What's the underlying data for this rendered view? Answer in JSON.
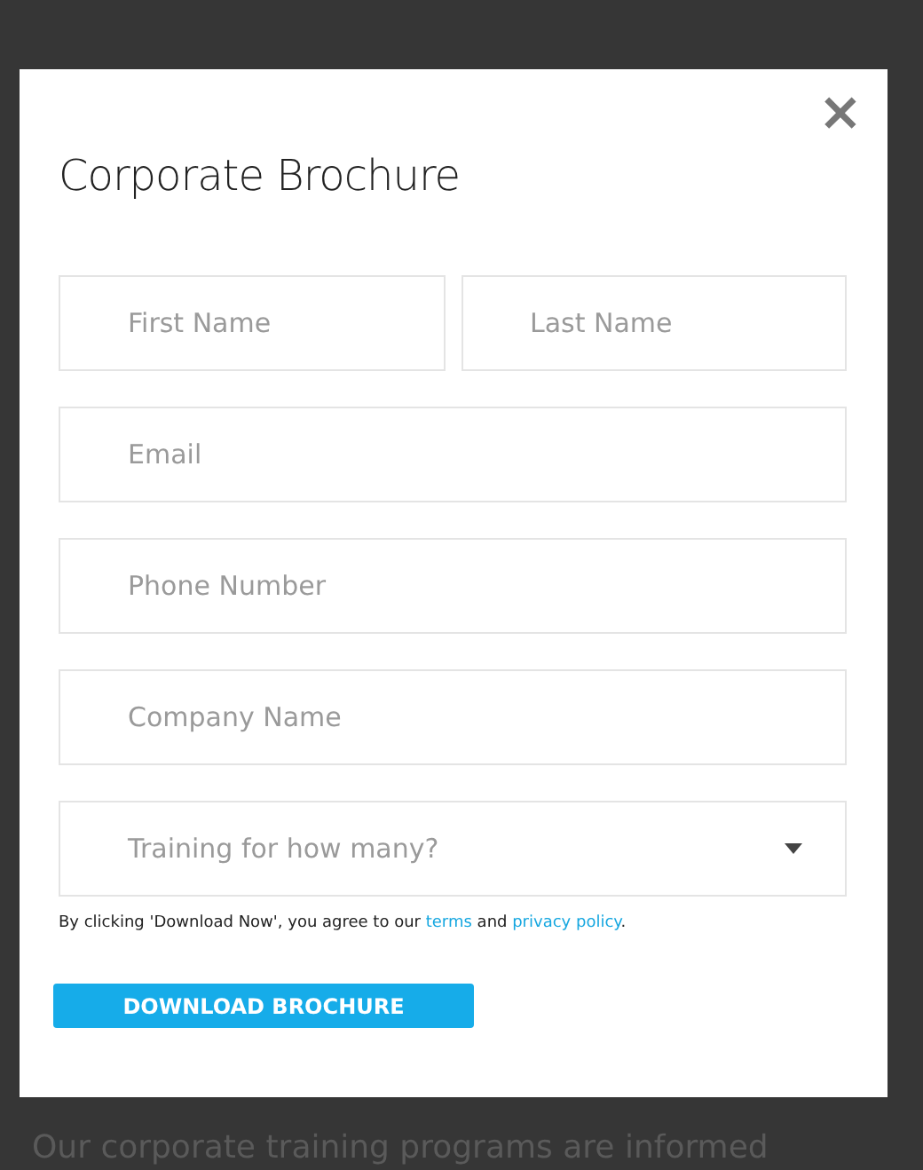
{
  "dialog": {
    "title": "Corporate Brochure",
    "close": "×",
    "fields": [
      {
        "kind": "input",
        "placeholder": "First Name",
        "half": true
      },
      {
        "kind": "input",
        "placeholder": "Last Name",
        "half": true
      },
      {
        "kind": "input",
        "placeholder": "Email",
        "half": false
      },
      {
        "kind": "input",
        "placeholder": "Phone Number",
        "half": false
      },
      {
        "kind": "input",
        "placeholder": "Company Name",
        "half": false
      },
      {
        "kind": "select",
        "placeholder": "Training for how many?",
        "half": false
      }
    ],
    "consent": {
      "before": "By clicking 'Download Now', you agree to our",
      "terms": "terms",
      "middle": "and",
      "privacy": "privacy policy",
      "after": "."
    },
    "button": "DOWNLOAD BROCHURE"
  },
  "background_text": "Our corporate training programs are informed"
}
